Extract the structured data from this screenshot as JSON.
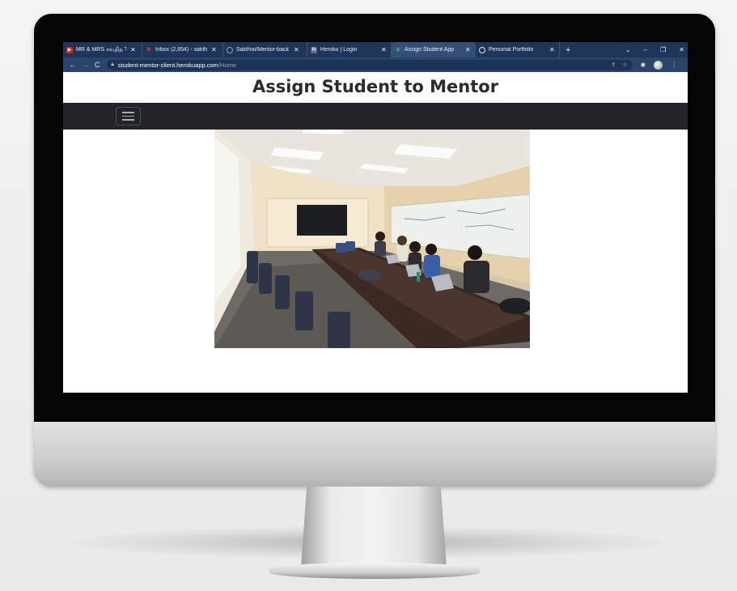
{
  "browser": {
    "tabs": [
      {
        "title": "MR & MRS சவுதித TA",
        "favicon_color": "#e62117",
        "active": false
      },
      {
        "title": "Inbox (2,654) - sakthi",
        "favicon_color": "#ea4335",
        "active": false
      },
      {
        "title": "Sakthiiii/Mentor-back",
        "favicon_color": "#24292f",
        "active": false
      },
      {
        "title": "Heroku | Login",
        "favicon_color": "#6762a6",
        "active": false
      },
      {
        "title": "Assign Student App",
        "favicon_color": "#61dafb",
        "active": true
      },
      {
        "title": "Personal Portfolio",
        "favicon_color": "#9aa0a6",
        "active": false
      }
    ],
    "new_tab_glyph": "+",
    "url_host": "student-mentor-client.herokuapp.com",
    "url_path": "/Home"
  },
  "page": {
    "heading": "Assign Student to Mentor",
    "menu_icon": "hamburger-icon",
    "hero_image": "classroom-photo"
  },
  "colors": {
    "tabstrip": "#1f3559",
    "toolbar": "#2a446a",
    "navbar": "#212529",
    "heading": "#2b2b2b"
  }
}
